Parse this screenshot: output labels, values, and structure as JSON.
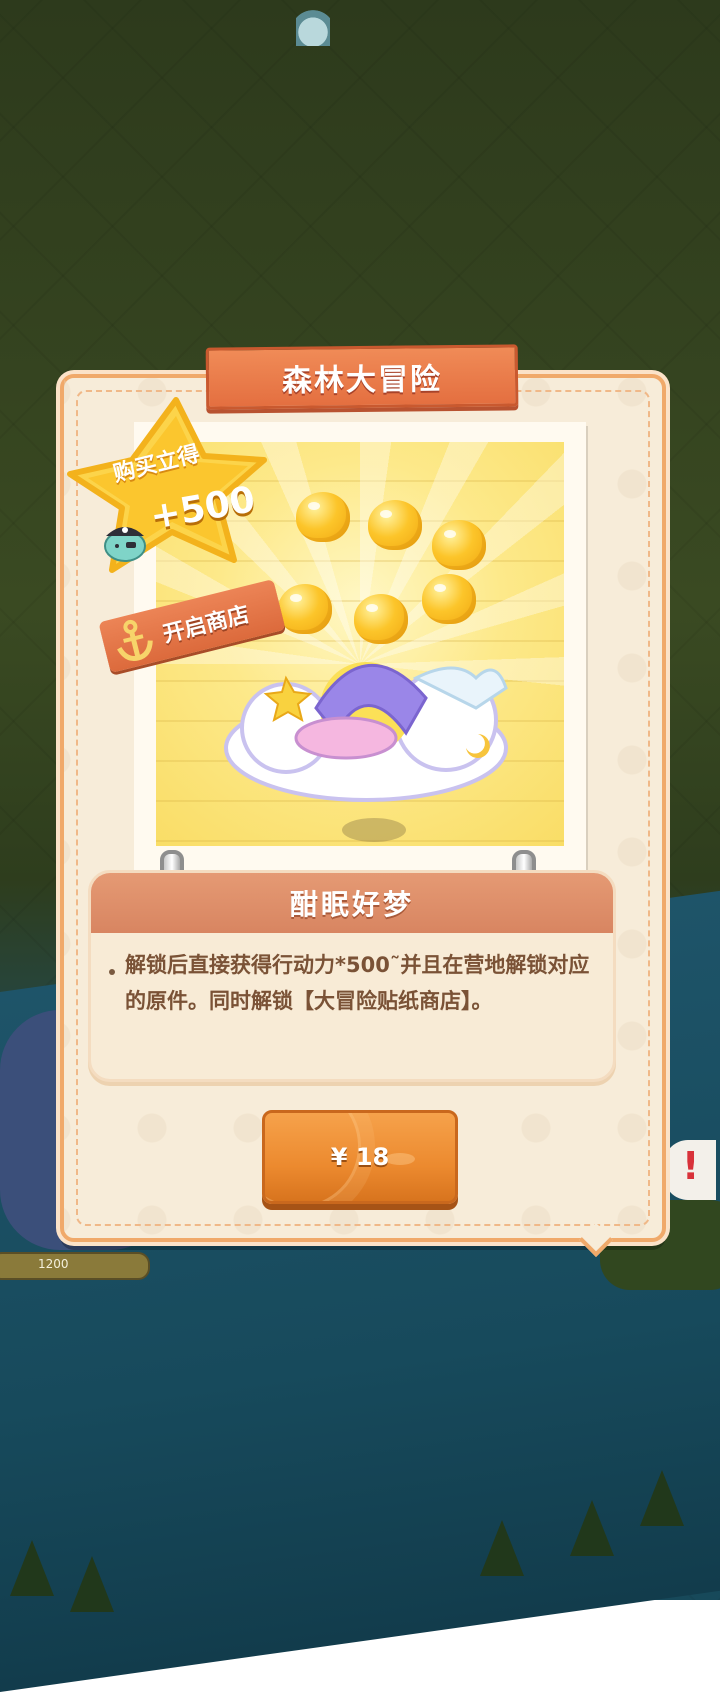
{
  "background": {
    "progress_value": "1200",
    "alert_symbol": "!"
  },
  "panel": {
    "title": "森林大冒险",
    "badge": {
      "line1": "购买立得",
      "amount": "+500",
      "icon": "pirate-slime-icon"
    },
    "shop_tag": {
      "label": "开启商店",
      "icon": "anchor-icon"
    },
    "reward": {
      "title": "酣眠好梦",
      "bullet": "•",
      "description": "解锁后直接获得行动力*500˜并且在营地解锁对应的原件。同时解锁【大冒险贴纸商店】。"
    },
    "buy_button": {
      "label": "¥ 18"
    }
  },
  "colors": {
    "panel_bg": "#f7ecd9",
    "panel_border": "#f0a96a",
    "ribbon": "#e46f40",
    "button": "#ec8a2f",
    "text_brown": "#7a5236"
  }
}
